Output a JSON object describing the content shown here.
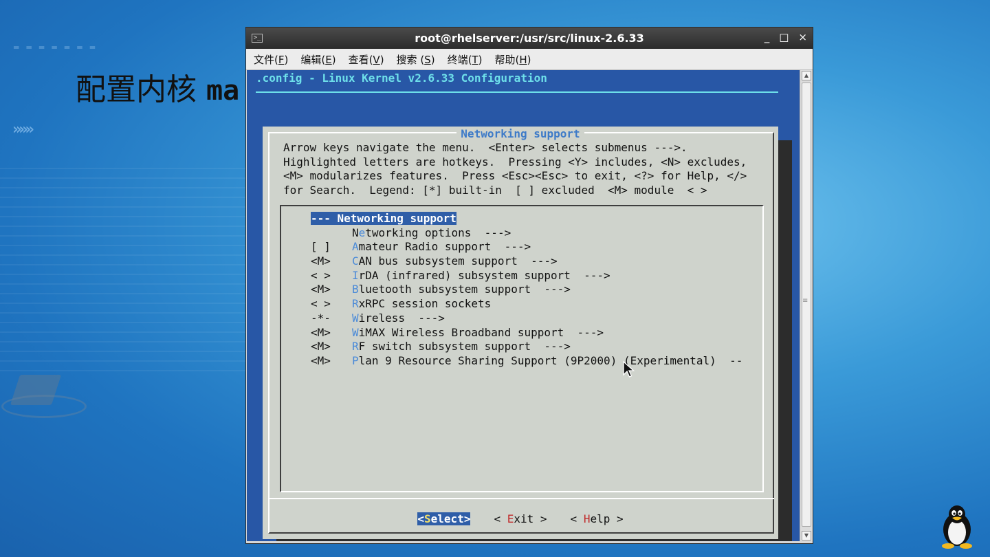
{
  "slide": {
    "title_cjk": "配置内核 ",
    "title_latin": "ma"
  },
  "window": {
    "title": "root@rhelserver:/usr/src/linux-2.6.33",
    "controls": {
      "minimize": "_",
      "maximize": "□",
      "close": "×"
    }
  },
  "menubar": [
    {
      "label": "文件(",
      "key": "F",
      "end": ")"
    },
    {
      "label": "编辑(",
      "key": "E",
      "end": ")"
    },
    {
      "label": "查看(",
      "key": "V",
      "end": ")"
    },
    {
      "label": "搜索 (",
      "key": "S",
      "end": ")"
    },
    {
      "label": "终端(",
      "key": "T",
      "end": ")"
    },
    {
      "label": "帮助(",
      "key": "H",
      "end": ")"
    }
  ],
  "terminal": {
    "header": ".config - Linux Kernel v2.6.33 Configuration",
    "dialog_title": "Networking support",
    "help_lines": [
      "Arrow keys navigate the menu.  <Enter> selects submenus --->.",
      "Highlighted letters are hotkeys.  Pressing <Y> includes, <N> excludes,",
      "<M> modularizes features.  Press <Esc><Esc> to exit, <?> for Help, </>",
      "for Search.  Legend: [*] built-in  [ ] excluded  <M> module  < >"
    ],
    "items": [
      {
        "prefix": "--- ",
        "hotkey": "",
        "rest": "Networking support",
        "selected": true
      },
      {
        "prefix": "",
        "hotkey_pre": "N",
        "hotkey": "e",
        "rest": "tworking options  --->"
      },
      {
        "prefix": "[ ]",
        "hotkey": "A",
        "rest": "mateur Radio support  --->"
      },
      {
        "prefix": "<M>",
        "hotkey": "C",
        "rest": "AN bus subsystem support  --->"
      },
      {
        "prefix": "< >",
        "hotkey": "I",
        "rest": "rDA (infrared) subsystem support  --->"
      },
      {
        "prefix": "<M>",
        "hotkey": "B",
        "rest": "luetooth subsystem support  --->"
      },
      {
        "prefix": "< >",
        "hotkey": "R",
        "rest": "xRPC session sockets"
      },
      {
        "prefix": "-*-",
        "hotkey": "W",
        "rest": "ireless  --->"
      },
      {
        "prefix": "<M>",
        "hotkey": "W",
        "rest": "iMAX Wireless Broadband support  --->"
      },
      {
        "prefix": "<M>",
        "hotkey": "R",
        "rest": "F switch subsystem support  --->"
      },
      {
        "prefix": "<M>",
        "hotkey": "P",
        "rest": "lan 9 Resource Sharing Support (9P2000) (Experimental)  --"
      }
    ],
    "buttons": [
      {
        "open": "<",
        "key": "S",
        "rest": "elect",
        "close": ">",
        "active": true
      },
      {
        "open": "< ",
        "key": "E",
        "rest": "xit",
        "close": " >",
        "active": false
      },
      {
        "open": "< ",
        "key": "H",
        "rest": "elp",
        "close": " >",
        "active": false
      }
    ]
  }
}
